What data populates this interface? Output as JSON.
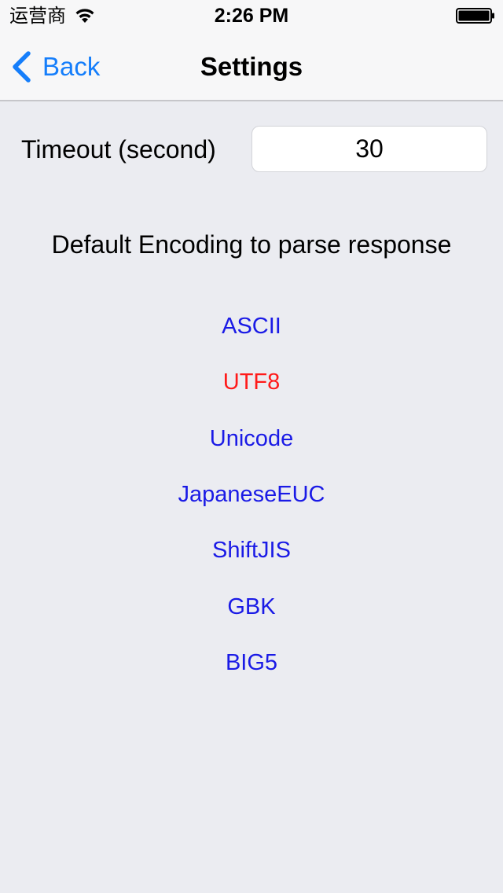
{
  "status_bar": {
    "carrier": "运营商",
    "time": "2:26 PM"
  },
  "nav": {
    "back_label": "Back",
    "title": "Settings"
  },
  "timeout": {
    "label": "Timeout (second)",
    "value": "30"
  },
  "encoding": {
    "heading": "Default Encoding to parse response",
    "selected": "UTF8",
    "options": [
      "ASCII",
      "UTF8",
      "Unicode",
      "JapaneseEUC",
      "ShiftJIS",
      "GBK",
      "BIG5"
    ]
  },
  "colors": {
    "accent": "#157EFB",
    "option": "#1A1AE6",
    "selected_option": "#FF1A1A",
    "background": "#EBECF1"
  }
}
